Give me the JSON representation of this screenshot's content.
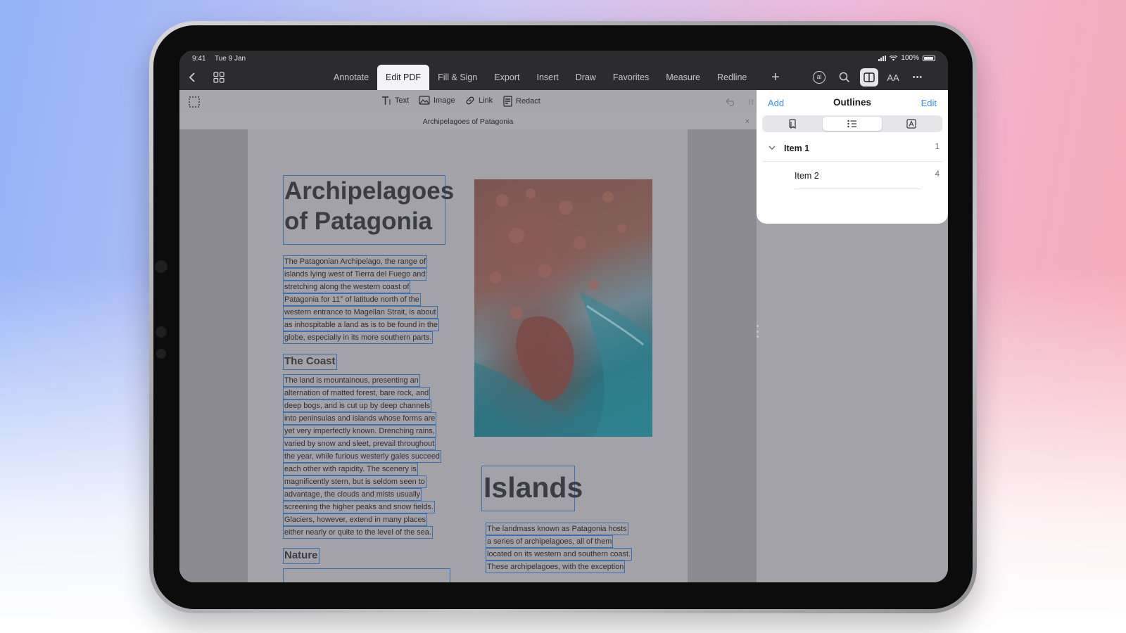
{
  "status_bar": {
    "time": "9:41",
    "date": "Tue 9 Jan",
    "battery": "100%"
  },
  "toolbar": {
    "tabs": [
      {
        "label": "Annotate",
        "active": false
      },
      {
        "label": "Edit PDF",
        "active": true
      },
      {
        "label": "Fill & Sign",
        "active": false
      },
      {
        "label": "Export",
        "active": false
      },
      {
        "label": "Insert",
        "active": false
      },
      {
        "label": "Draw",
        "active": false
      },
      {
        "label": "Favorites",
        "active": false
      },
      {
        "label": "Measure",
        "active": false
      },
      {
        "label": "Redline",
        "active": false
      }
    ],
    "plus_label": "+",
    "ai_label": "ai",
    "text_size_label": "AA",
    "more_label": "•••"
  },
  "edit_tools": {
    "text": "Text",
    "image": "Image",
    "link": "Link",
    "redact": "Redact"
  },
  "document": {
    "title": "Archipelagoes of Patagonia",
    "close_label": "×",
    "heading_lines": [
      "Archipelagoes",
      "of Patagonia"
    ],
    "intro_lines": [
      "The Patagonian Archipelago, the range of",
      "islands lying west of Tierra del Fuego and",
      "stretching along the western coast of",
      "Patagonia for 11° of latitude north of the",
      "western entrance to Magellan Strait, is about",
      "as inhospitable a land as is to be found in the",
      "globe, especially in its more southern parts."
    ],
    "coast_heading": "The Coast",
    "coast_lines": [
      "The land is mountainous, presenting an",
      "alternation of matted forest, bare rock, and",
      "deep bogs, and is cut up by deep channels",
      "into peninsulas and islands whose forms are",
      "yet very imperfectly known. Drenching rains,",
      "varied by snow and sleet, prevail throughout",
      "the year, while furious westerly gales succeed",
      "each other with rapidity. The scenery is",
      "magnificently stern, but is seldom seen to",
      "advantage, the clouds and mists usually",
      "screening the higher peaks and snow fields.",
      "Glaciers, however, extend in many places",
      "either nearly or quite to the level of the sea."
    ],
    "nature_heading": "Nature",
    "islands_heading": "Islands",
    "islands_lines": [
      "The landmass known as Patagonia hosts",
      "a series of archipelagoes, all of them",
      "located on its western and southern coast.",
      "These archipelagoes, with the exception"
    ]
  },
  "outline_panel": {
    "add_label": "Add",
    "title": "Outlines",
    "edit_label": "Edit",
    "items": [
      {
        "label": "Item 1",
        "page": "1",
        "expanded": true
      },
      {
        "label": "Item 2",
        "page": "4"
      }
    ]
  },
  "colors": {
    "accent": "#3d8cf0",
    "selection_border": "#3b6fb0",
    "toolbar": "#2c2c2e"
  }
}
